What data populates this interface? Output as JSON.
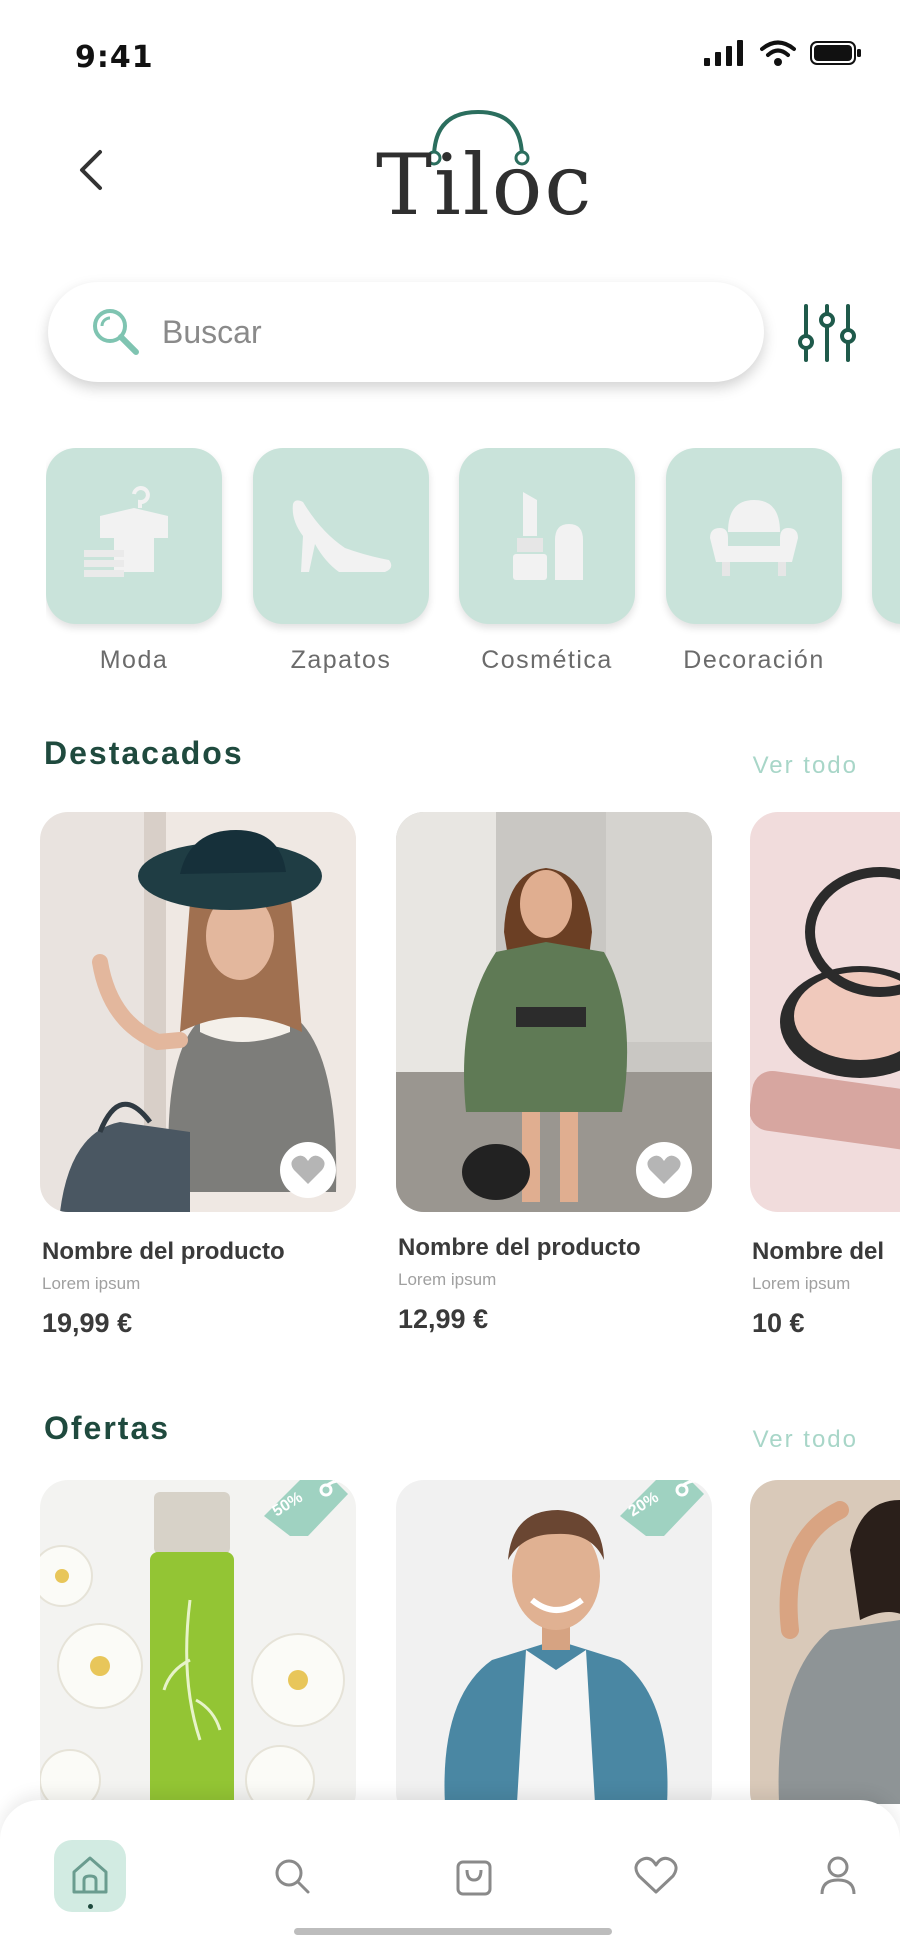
{
  "status_bar": {
    "time": "9:41"
  },
  "header": {
    "logo_text": "Tiloc"
  },
  "search": {
    "placeholder": "Buscar"
  },
  "categories": [
    {
      "label": "Moda",
      "icon": "clothes-hanger-icon"
    },
    {
      "label": "Zapatos",
      "icon": "high-heel-icon"
    },
    {
      "label": "Cosmética",
      "icon": "lipstick-icon"
    },
    {
      "label": "Decoración",
      "icon": "armchair-icon"
    }
  ],
  "featured": {
    "title": "Destacados",
    "see_all": "Ver todo",
    "products": [
      {
        "name": "Nombre del producto",
        "subtitle": "Lorem ipsum",
        "price": "19,99 €"
      },
      {
        "name": "Nombre del producto",
        "subtitle": "Lorem ipsum",
        "price": "12,99 €"
      },
      {
        "name": "Nombre del",
        "subtitle": "Lorem ipsum",
        "price": "10 €"
      }
    ]
  },
  "offers": {
    "title": "Ofertas",
    "see_all": "Ver todo",
    "items": [
      {
        "discount": "50%"
      },
      {
        "discount": "20%"
      }
    ]
  },
  "colors": {
    "accent": "#c9e3da",
    "title": "#1f4a3e",
    "link": "#a8d6c8",
    "icon": "#1f5a4b"
  },
  "bottom_nav": [
    "home-icon",
    "search-icon",
    "shopping-bag-icon",
    "heart-icon",
    "user-icon"
  ]
}
